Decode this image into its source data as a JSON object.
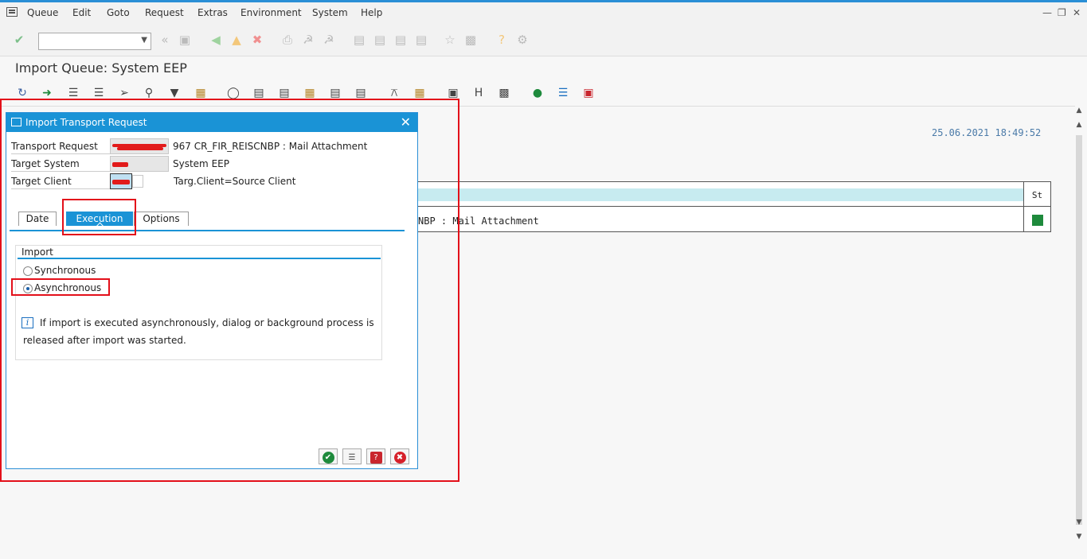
{
  "menu": [
    "Queue",
    "Edit",
    "Goto",
    "Request",
    "Extras",
    "Environment",
    "System",
    "Help"
  ],
  "window_controls": [
    "—",
    "❐",
    "✕"
  ],
  "page_title": "Import Queue: System EEP",
  "timestamp": "25.06.2021 18:49:52",
  "queue_table": {
    "status_header": "St",
    "row_text": "NBP : Mail Attachment",
    "status_color": "#1e8a3c"
  },
  "dialog": {
    "title": "Import Transport Request",
    "fields": {
      "transport_request_label": "Transport Request",
      "transport_request_desc": "967 CR_FIR_REISCNBP : Mail Attachment",
      "target_system_label": "Target System",
      "target_system_desc": "System EEP",
      "target_client_label": "Target Client",
      "target_client_desc": "Targ.Client=Source Client"
    },
    "tabs": [
      "Date",
      "Execution",
      "Options"
    ],
    "active_tab": "Execution",
    "import_group": {
      "title": "Import",
      "options": [
        "Synchronous",
        "Asynchronous"
      ],
      "selected": "Asynchronous",
      "info_line1": "If import is executed asynchronously, dialog or background process is",
      "info_line2": "released after import was started."
    },
    "buttons": [
      "confirm",
      "schedule",
      "help",
      "cancel"
    ]
  },
  "colors": {
    "accent": "#1a93d6",
    "highlight_red": "#e3101a"
  }
}
